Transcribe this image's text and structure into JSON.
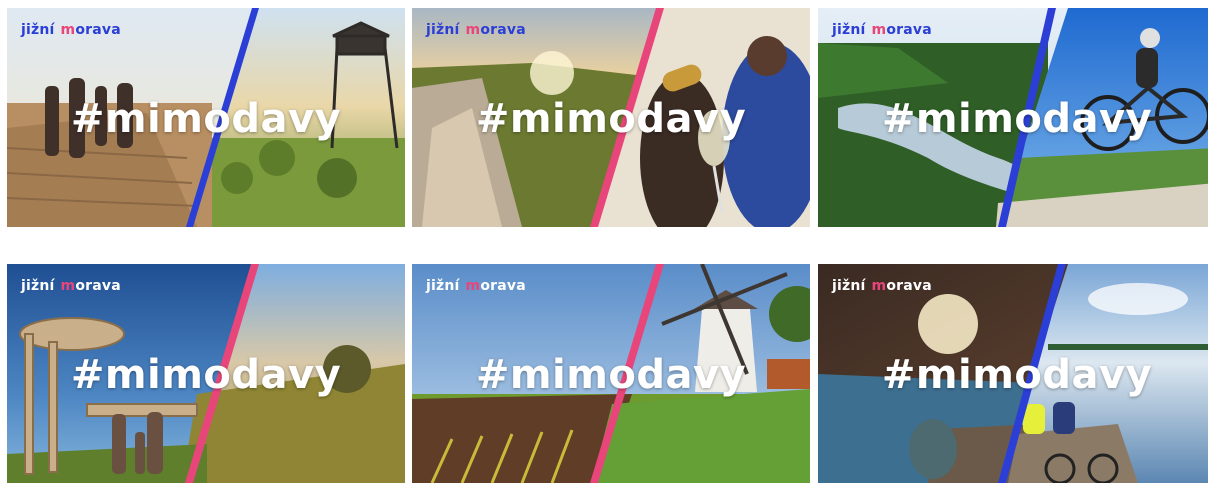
{
  "brand": {
    "word1": "jižní",
    "m_letter": "m",
    "word2_rest": "orava"
  },
  "hashtag": "#mimodavy",
  "colors": {
    "brand_blue": "#2b3fd6",
    "brand_pink": "#e8457a",
    "tag_text": "#ffffff"
  },
  "tiles": [
    {
      "name": "lookout-tower",
      "brand_color": "#2b3fd6",
      "divider": "blue"
    },
    {
      "name": "vineyard-wine",
      "brand_color": "#2b3fd6",
      "divider": "pink"
    },
    {
      "name": "river-cyclist",
      "brand_color": "#2b3fd6",
      "divider": "blue"
    },
    {
      "name": "wooden-walkway",
      "brand_color": "#ffffff",
      "divider": "pink"
    },
    {
      "name": "windmill-field",
      "brand_color": "#ffffff",
      "divider": "pink"
    },
    {
      "name": "lake-pier",
      "brand_color": "#ffffff",
      "divider": "blue"
    }
  ]
}
